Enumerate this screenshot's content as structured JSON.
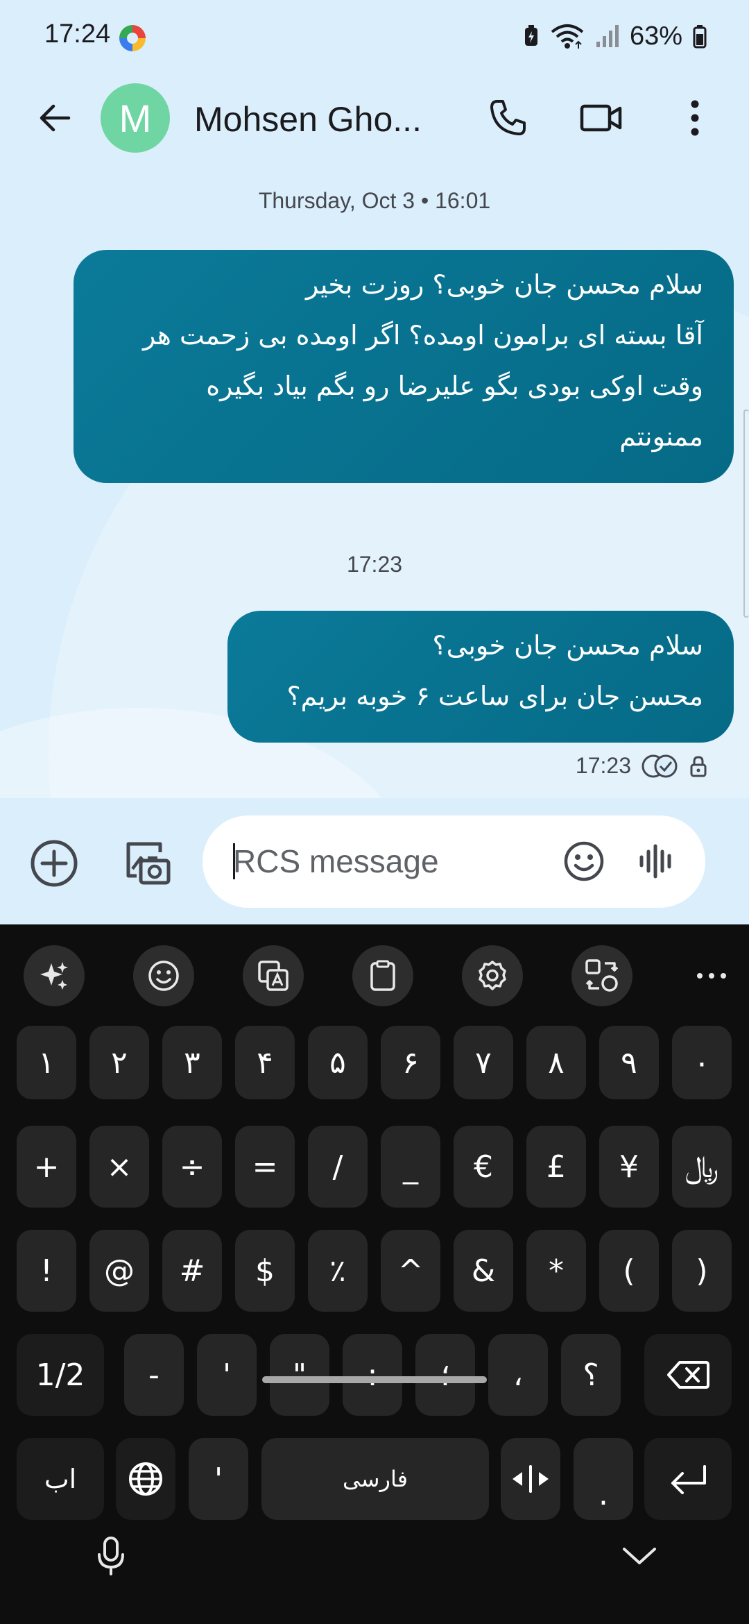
{
  "status_bar": {
    "time": "17:24",
    "battery": "63%",
    "icons": [
      "app-notification-icon",
      "battery-saver-icon",
      "wifi-icon",
      "signal-icon",
      "battery-icon"
    ]
  },
  "app_bar": {
    "avatar_letter": "M",
    "contact_name": "Mohsen Gho...",
    "avatar_color": "#6fd6a3",
    "icons": [
      "back-arrow-icon",
      "phone-icon",
      "video-call-icon",
      "more-vert-icon"
    ]
  },
  "conversation": {
    "date_separator": "Thursday, Oct 3 • 16:01",
    "time_separator": "17:23",
    "messages": [
      {
        "lines": [
          "سلام محسن جان خوبی؟ روزت بخیر",
          "آقا بسته ای برامون اومده؟ اگر اومده بی زحمت هر",
          "وقت اوکی بودی بگو علیرضا رو بگم بیاد بگیره",
          "ممنونتم"
        ]
      },
      {
        "lines": [
          "سلام محسن جان خوبی؟",
          "محسن جان برای ساعت ۶ خوبه بریم؟"
        ],
        "timestamp": "17:23",
        "status": "delivered-read-icon"
      }
    ],
    "bubble_color": "#0b7a99"
  },
  "compose": {
    "placeholder": "RCS message",
    "value": "",
    "icons": [
      "add-circle-icon",
      "gallery-icon",
      "emoji-icon",
      "voice-message-icon"
    ]
  },
  "keyboard": {
    "toolbar": [
      "ai-sparkle-icon",
      "emoji-icon",
      "translate-icon",
      "clipboard-icon",
      "settings-icon",
      "mode-switch-icon",
      "more-horiz-icon"
    ],
    "row1": [
      "۱",
      "۲",
      "۳",
      "۴",
      "۵",
      "۶",
      "۷",
      "۸",
      "۹",
      "۰"
    ],
    "row2": [
      "+",
      "×",
      "÷",
      "=",
      "/",
      "_",
      "€",
      "£",
      "¥",
      "﷼"
    ],
    "row3": [
      "!",
      "@",
      "#",
      "$",
      "٪",
      "^",
      "&",
      "*",
      "(",
      ")"
    ],
    "row4": [
      "1/2",
      "-",
      "'",
      "\"",
      ":",
      "؛",
      "،",
      "؟"
    ],
    "row5": {
      "lang_key": "اب",
      "apostrophe": "'",
      "space": "فارسی",
      "period": "."
    },
    "bottom_icons": [
      "microphone-icon",
      "hide-keyboard-icon"
    ]
  }
}
